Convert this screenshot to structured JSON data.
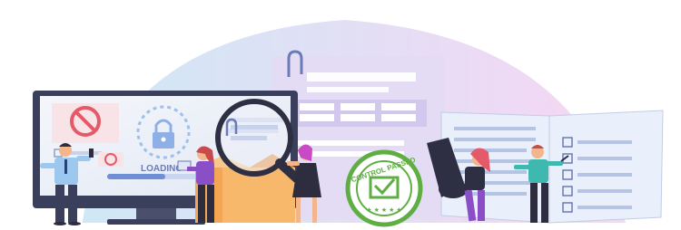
{
  "illustration": {
    "loading_text": "LOADING",
    "seal_text": "CONTROL PASSED",
    "colors": {
      "arc_left": "#cfe8f6",
      "arc_right": "#f6d6f3",
      "monitor_frame": "#3a3f5c",
      "monitor_screen": "#eef1f8",
      "prohibited_red": "#e45a6a",
      "lock_blue": "#8fb0e6",
      "document_purple": "#e4dcf5",
      "box_orange": "#f4a654",
      "seal_green": "#5fae43",
      "book_light": "#eaf0fb",
      "magnifier_dark": "#2f2f44"
    }
  }
}
